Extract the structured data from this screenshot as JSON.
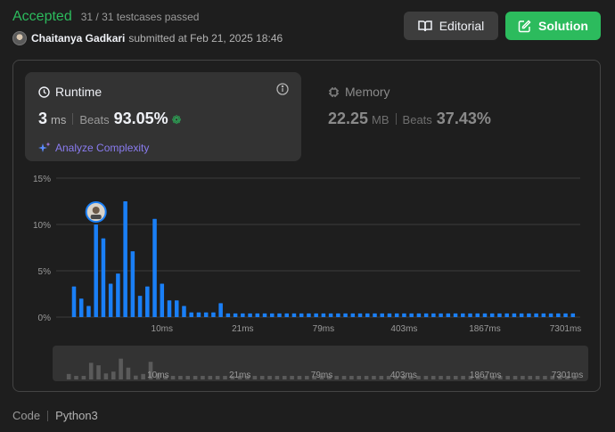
{
  "status": {
    "label": "Accepted",
    "testcases": "31 / 31 testcases passed",
    "user": "Chaitanya Gadkari",
    "submitted_text": "submitted at Feb 21, 2025 18:46"
  },
  "buttons": {
    "editorial": "Editorial",
    "solution": "Solution"
  },
  "runtime": {
    "title": "Runtime",
    "value": "3",
    "unit": "ms",
    "beats_label": "Beats",
    "beats_value": "93.05%",
    "analyze_label": "Analyze Complexity"
  },
  "memory": {
    "title": "Memory",
    "value": "22.25",
    "unit": "MB",
    "beats_label": "Beats",
    "beats_value": "37.43%"
  },
  "footer": {
    "label": "Code",
    "language": "Python3"
  },
  "colors": {
    "accent_green": "#2cbb5d",
    "bar_blue": "#1a7ff6",
    "analyze_purple": "#8a7cf0"
  },
  "chart_data": {
    "type": "bar",
    "y_ticks": [
      "15%",
      "10%",
      "5%",
      "0%"
    ],
    "ylim": [
      0,
      15
    ],
    "x_tick_labels": [
      "10ms",
      "21ms",
      "79ms",
      "403ms",
      "1867ms",
      "7301ms"
    ],
    "x_tick_bar_index": [
      12,
      23,
      34,
      45,
      56,
      67
    ],
    "values": [
      3.3,
      2.0,
      1.2,
      10.0,
      8.5,
      3.6,
      4.7,
      12.5,
      7.1,
      2.3,
      3.3,
      10.6,
      3.6,
      1.8,
      1.8,
      1.2,
      0.5,
      0.5,
      0.5,
      0.5,
      1.5,
      0.4,
      0.4,
      0.4,
      0.4,
      0.4,
      0.4,
      0.4,
      0.4,
      0.4,
      0.4,
      0.4,
      0.4,
      0.4,
      0.4,
      0.4,
      0.4,
      0.4,
      0.4,
      0.4,
      0.4,
      0.4,
      0.4,
      0.4,
      0.4,
      0.4,
      0.4,
      0.4,
      0.4,
      0.4,
      0.4,
      0.4,
      0.4,
      0.4,
      0.4,
      0.4,
      0.4,
      0.4,
      0.4,
      0.4,
      0.4,
      0.4,
      0.4,
      0.4,
      0.4,
      0.4,
      0.4,
      0.4,
      0.4
    ],
    "highlight_index": 3
  }
}
